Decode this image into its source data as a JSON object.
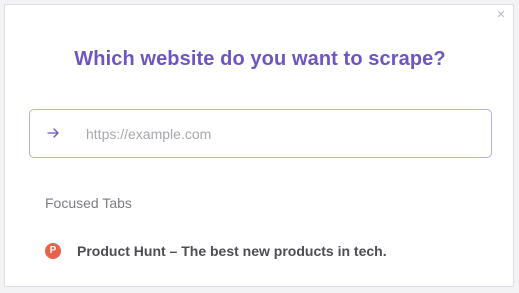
{
  "dialog": {
    "title": "Which website do you want to scrape?",
    "close_icon": "close-icon"
  },
  "url_input": {
    "placeholder": "https://example.com",
    "value": "",
    "icon": "arrow-right-icon"
  },
  "focused_tabs": {
    "label": "Focused Tabs",
    "items": [
      {
        "favicon_letter": "P",
        "favicon_color": "#e8614a",
        "title": "Product Hunt – The best new products in tech."
      }
    ]
  },
  "colors": {
    "accent": "#6e55c2",
    "input_border": "#b8addf"
  }
}
